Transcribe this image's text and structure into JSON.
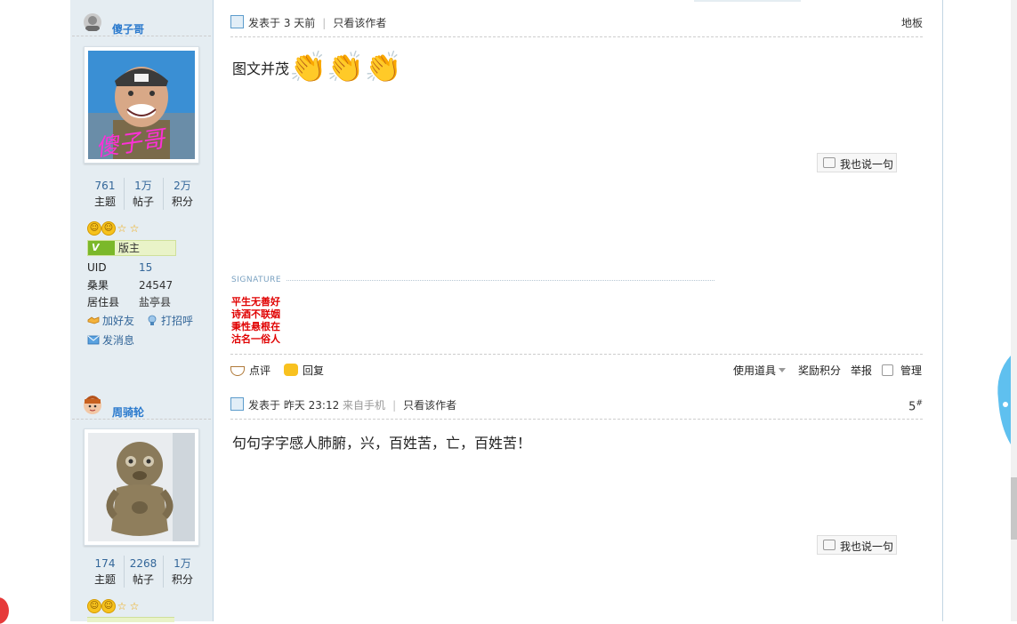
{
  "authors": [
    {
      "name": "傻子哥",
      "avatar_text": "傻子哥",
      "stats": [
        {
          "num": "761",
          "label": "主题"
        },
        {
          "num": "1万",
          "label": "帖子"
        },
        {
          "num": "2万",
          "label": "积分"
        }
      ],
      "role": "版主",
      "info": [
        {
          "key": "UID",
          "value": "15"
        },
        {
          "key": "桑果",
          "value": "24547"
        },
        {
          "key": "居住县",
          "value": "盐亭县"
        }
      ],
      "actions": {
        "add_friend": "加好友",
        "greet": "打招呼",
        "message": "发消息"
      }
    },
    {
      "name": "周骑轮",
      "stats": [
        {
          "num": "174",
          "label": "主题"
        },
        {
          "num": "2268",
          "label": "帖子"
        },
        {
          "num": "1万",
          "label": "积分"
        }
      ]
    }
  ],
  "posts": [
    {
      "posted": "发表于 3 天前",
      "only_author": "只看该作者",
      "floor": "地板",
      "content": "图文并茂",
      "comment_button": "我也说一句",
      "signature_label": "SIGNATURE",
      "signature_lines": [
        "平生无善好",
        "诗酒不联姻",
        "秉性悬根在",
        "沽名一俗人"
      ],
      "footer": {
        "review": "点评",
        "reply": "回复",
        "use_item": "使用道具",
        "reward": "奖励积分",
        "report": "举报",
        "manage": "管理"
      }
    },
    {
      "posted": "发表于 昨天 23:12",
      "from": "来自手机",
      "only_author": "只看该作者",
      "floor_num": "5",
      "floor_mark": "#",
      "content": "句句字字感人肺腑，兴，百姓苦，亡，百姓苦！",
      "comment_button": "我也说一句"
    }
  ],
  "colors": {
    "sidebar_bg": "#e5edf2",
    "link": "#336699",
    "name": "#2b7acd",
    "signature": "#e00000"
  }
}
